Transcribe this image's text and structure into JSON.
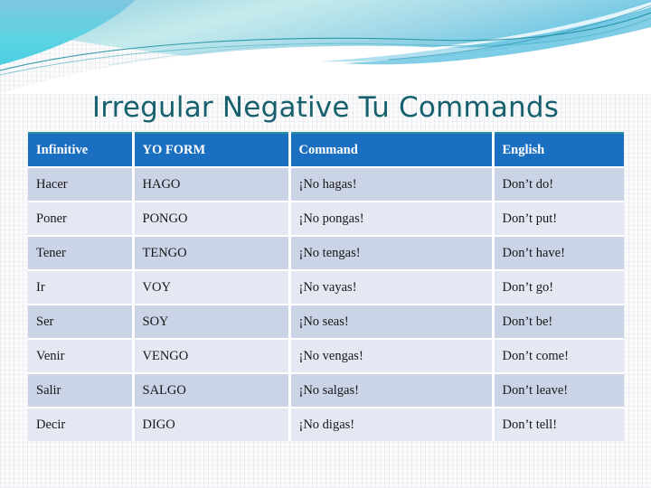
{
  "slide": {
    "title": "Irregular Negative Tu Commands",
    "theme": {
      "title_color": "#17616E",
      "header_fill": "#1B6FC1",
      "header_text_color": "#FFFFFF",
      "row_odd_fill": "#CBD3E6",
      "row_even_fill": "#E4E8F3",
      "wave_cyan": "#5FD2E0",
      "wave_blue": "#7FC4E6",
      "wave_teal_line": "#168C9C",
      "background": "#FBFBFC"
    }
  },
  "table": {
    "columns": [
      "Infinitive",
      "YO FORM",
      "Command",
      "English"
    ],
    "rows": [
      {
        "infinitive": "Hacer",
        "yo_form": "HAGO",
        "command": "¡No hagas!",
        "english": "Don’t do!"
      },
      {
        "infinitive": "Poner",
        "yo_form": "PONGO",
        "command": "¡No pongas!",
        "english": "Don’t put!"
      },
      {
        "infinitive": "Tener",
        "yo_form": "TENGO",
        "command": "¡No tengas!",
        "english": "Don’t have!"
      },
      {
        "infinitive": "Ir",
        "yo_form": "VOY",
        "command": "¡No vayas!",
        "english": "Don’t go!"
      },
      {
        "infinitive": "Ser",
        "yo_form": "SOY",
        "command": "¡No seas!",
        "english": "Don’t be!"
      },
      {
        "infinitive": "Venir",
        "yo_form": "VENGO",
        "command": "¡No vengas!",
        "english": "Don’t come!"
      },
      {
        "infinitive": "Salir",
        "yo_form": "SALGO",
        "command": "¡No salgas!",
        "english": "Don’t leave!"
      },
      {
        "infinitive": "Decir",
        "yo_form": "DIGO",
        "command": "¡No digas!",
        "english": "Don’t tell!"
      }
    ]
  }
}
